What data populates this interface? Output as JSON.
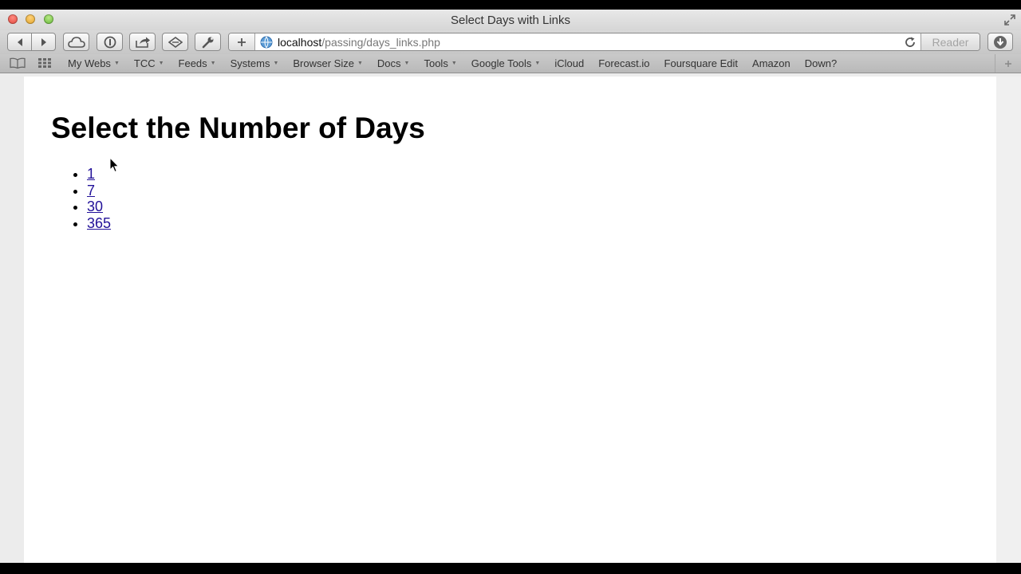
{
  "window": {
    "title": "Select Days with Links"
  },
  "toolbar": {
    "url_host": "localhost",
    "url_path": "/passing/days_links.php",
    "reader_label": "Reader"
  },
  "bookmarks": [
    {
      "label": "My Webs",
      "menu": true
    },
    {
      "label": "TCC",
      "menu": true
    },
    {
      "label": "Feeds",
      "menu": true
    },
    {
      "label": "Systems",
      "menu": true
    },
    {
      "label": "Browser Size",
      "menu": true
    },
    {
      "label": "Docs",
      "menu": true
    },
    {
      "label": "Tools",
      "menu": true
    },
    {
      "label": "Google Tools",
      "menu": true
    },
    {
      "label": "iCloud",
      "menu": false
    },
    {
      "label": "Forecast.io",
      "menu": false
    },
    {
      "label": "Foursquare Edit",
      "menu": false
    },
    {
      "label": "Amazon",
      "menu": false
    },
    {
      "label": "Down?",
      "menu": false
    }
  ],
  "page": {
    "heading": "Select the Number of Days",
    "day_links": [
      "1",
      "7",
      "30",
      "365"
    ]
  },
  "colors": {
    "link": "#221199"
  }
}
